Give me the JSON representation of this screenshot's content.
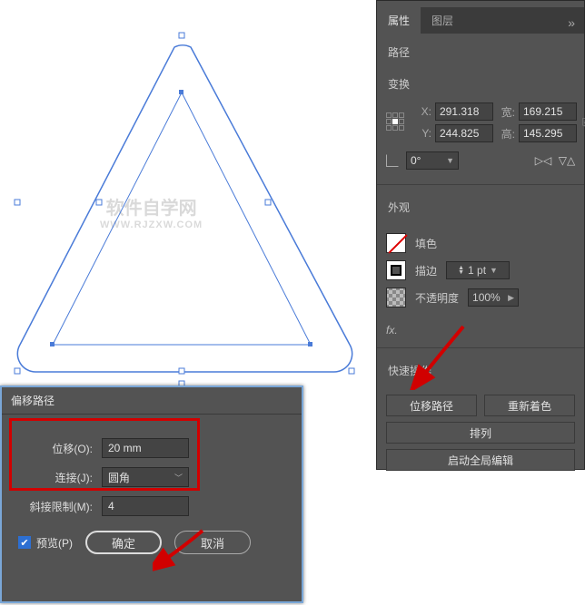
{
  "canvas": {
    "watermark_line1": "软件自学网",
    "watermark_line2": "WWW.RJZXW.COM"
  },
  "panel": {
    "tabs": {
      "properties": "属性",
      "layers": "图层"
    },
    "object_type": "路径",
    "transform": {
      "label": "变换",
      "x_label": "X:",
      "y_label": "Y:",
      "w_label": "宽:",
      "h_label": "高:",
      "x": "291.318",
      "y": "244.825",
      "w": "169.215",
      "h": "145.295",
      "angle": "0°"
    },
    "appearance": {
      "label": "外观",
      "fill": "填色",
      "stroke": "描边",
      "stroke_weight": "1 pt",
      "opacity_label": "不透明度",
      "opacity": "100%",
      "fx": "fx."
    },
    "quick": {
      "label": "快速操作",
      "offset_path": "位移路径",
      "recolor": "重新着色",
      "arrange": "排列",
      "global_edit": "启动全局编辑"
    }
  },
  "dialog": {
    "title": "偏移路径",
    "offset_label": "位移(O):",
    "offset_value": "20 mm",
    "joins_label": "连接(J):",
    "joins_value": "圆角",
    "miter_label": "斜接限制(M):",
    "miter_value": "4",
    "preview": "预览(P)",
    "ok": "确定",
    "cancel": "取消"
  }
}
